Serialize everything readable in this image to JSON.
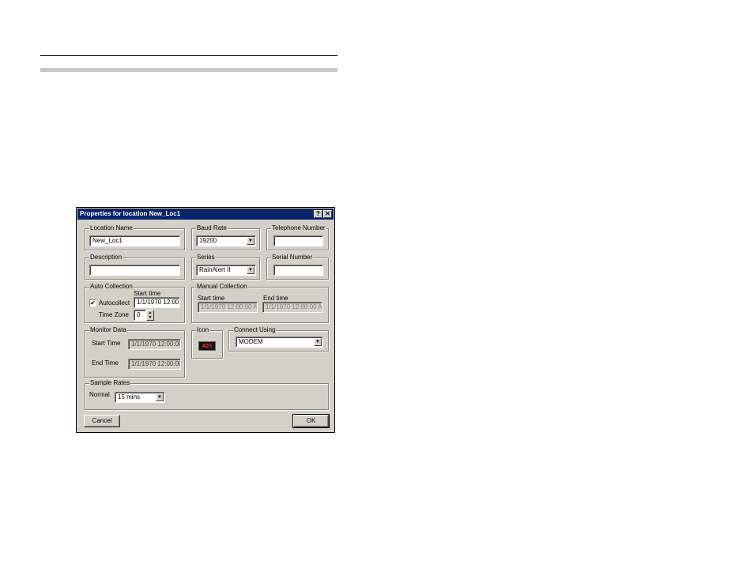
{
  "dialog": {
    "title": "Properties for location New_Loc1",
    "help_button": "?",
    "close_button": "✕"
  },
  "location_name": {
    "label": "Location Name",
    "value": "New_Loc1"
  },
  "baud_rate": {
    "label": "Baud Rate",
    "value": "19200"
  },
  "telephone": {
    "label": "Telephone Number",
    "value": ""
  },
  "description": {
    "label": "Description",
    "value": ""
  },
  "series": {
    "label": "Series",
    "value": "RainAlert II"
  },
  "serial_number": {
    "label": "Serial Number",
    "value": ""
  },
  "auto_collection": {
    "label": "Auto Collection",
    "autocollect_label": "Autocollect",
    "autocollect_checked": true,
    "check_mark": "✔",
    "start_time_label": "Start time",
    "start_time": "1/1/1970 12:00",
    "time_zone_label": "Time Zone",
    "time_zone": "0"
  },
  "manual_collection": {
    "label": "Manual Collection",
    "start_time_label": "Start time",
    "start_time": "1/1/1970 12:00:00 A",
    "end_time_label": "End time",
    "end_time": "1/1/1970 12:00:00 A"
  },
  "monitor_data": {
    "label": "Monitor Data",
    "start_time_label": "Start Time",
    "start_time": "1/1/1970 12:00:00",
    "end_time_label": "End Time",
    "end_time": "1/1/1970 12:00:00"
  },
  "icon_group": {
    "label": "Icon",
    "icon_text": "ADS"
  },
  "connect_using": {
    "label": "Connect Using",
    "value": "MODEM"
  },
  "sample_rates": {
    "label": "Sample Rates",
    "normal_label": "Normal",
    "normal_value": "15 mins"
  },
  "buttons": {
    "cancel": "Cancel",
    "ok": "OK"
  },
  "dropdown_arrow": "▼",
  "spin_up": "▲",
  "spin_down": "▼"
}
